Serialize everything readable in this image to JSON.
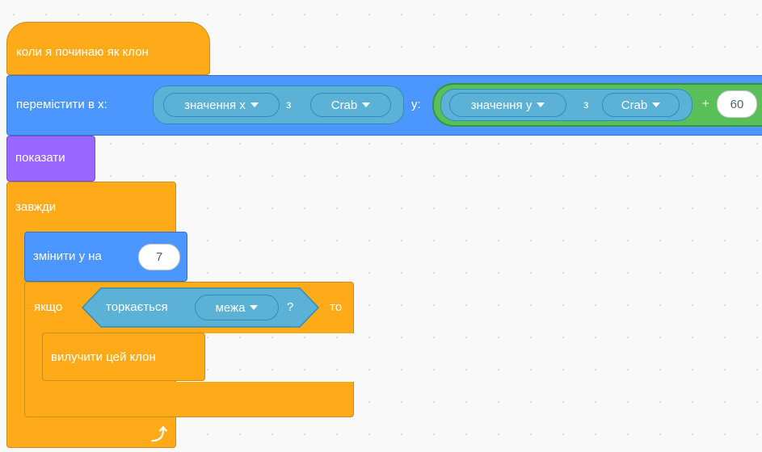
{
  "colors": {
    "events": "#ffab19",
    "motion": "#4c97ff",
    "looks": "#9966ff",
    "control": "#ffab19",
    "sensing": "#5cb1d6",
    "operators": "#59c059"
  },
  "hat": {
    "label": "коли я починаю як клон"
  },
  "goto": {
    "label": "перемістити в x:",
    "x_of": {
      "prop": "значення x",
      "of": "з",
      "sprite": "Crab"
    },
    "y_label": "y:",
    "y_expr": {
      "prop": "значення y",
      "of": "з",
      "sprite": "Crab",
      "op": "+",
      "addend": "60"
    }
  },
  "show": {
    "label": "показати"
  },
  "forever": {
    "label": "завжди",
    "loop_icon": "loop-arrow-icon"
  },
  "change_y": {
    "label": "змінити y на",
    "value": "7"
  },
  "if_block": {
    "label": "якщо",
    "condition": {
      "label": "торкається",
      "target": "межа",
      "q": "?"
    },
    "then": "то"
  },
  "delete_clone": {
    "label": "вилучити цей клон"
  }
}
